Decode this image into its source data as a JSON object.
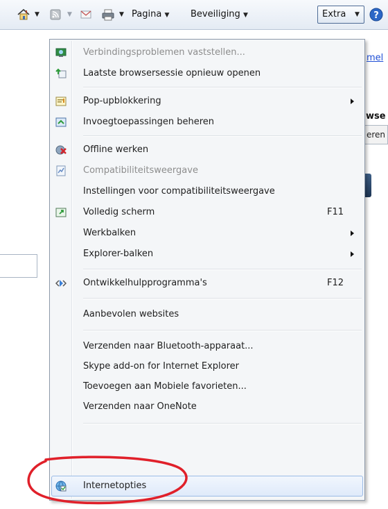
{
  "toolbar": {
    "pagina_label": "Pagina",
    "beveiliging_label": "Beveiliging",
    "extra_label": "Extra",
    "icons": [
      "home-icon",
      "rss-feed-icon",
      "read-mail-icon",
      "print-icon",
      "help-icon"
    ]
  },
  "background": {
    "link_fragment": "mel",
    "text_fragment": "wse",
    "button_fragment": "eren"
  },
  "menu": {
    "items": [
      {
        "label": "Verbindingsproblemen vaststellen...",
        "disabled": true,
        "icon": "diagnose-connection-icon"
      },
      {
        "label": "Laatste browsersessie opnieuw openen",
        "icon": "reopen-session-icon"
      },
      {
        "label": "Pop-upblokkering",
        "submenu": true,
        "icon": "popup-blocker-icon"
      },
      {
        "label": "Invoegtoepassingen beheren",
        "icon": "manage-addons-icon"
      },
      {
        "label": "Offline werken",
        "icon": "offline-icon"
      },
      {
        "label": "Compatibiliteitsweergave",
        "disabled": true,
        "icon": "compatibility-view-icon"
      },
      {
        "label": "Instellingen voor compatibiliteitsweergave"
      },
      {
        "label": "Volledig scherm",
        "shortcut": "F11",
        "icon": "full-screen-icon"
      },
      {
        "label": "Werkbalken",
        "submenu": true
      },
      {
        "label": "Explorer-balken",
        "submenu": true
      },
      {
        "label": "Ontwikkelhulpprogramma's",
        "shortcut": "F12",
        "icon": "developer-tools-icon"
      },
      {
        "label": "Aanbevolen websites"
      },
      {
        "label": "Verzenden naar Bluetooth-apparaat..."
      },
      {
        "label": "Skype add-on for Internet Explorer"
      },
      {
        "label": "Toevoegen aan Mobiele favorieten..."
      },
      {
        "label": "Verzenden naar OneNote"
      },
      {
        "label": "Internetopties",
        "highlighted": true,
        "icon": "internet-options-icon"
      }
    ]
  },
  "colors": {
    "annotation": "#e0202a",
    "highlight_border": "#9bbbe6",
    "link": "#1f4fd6"
  }
}
